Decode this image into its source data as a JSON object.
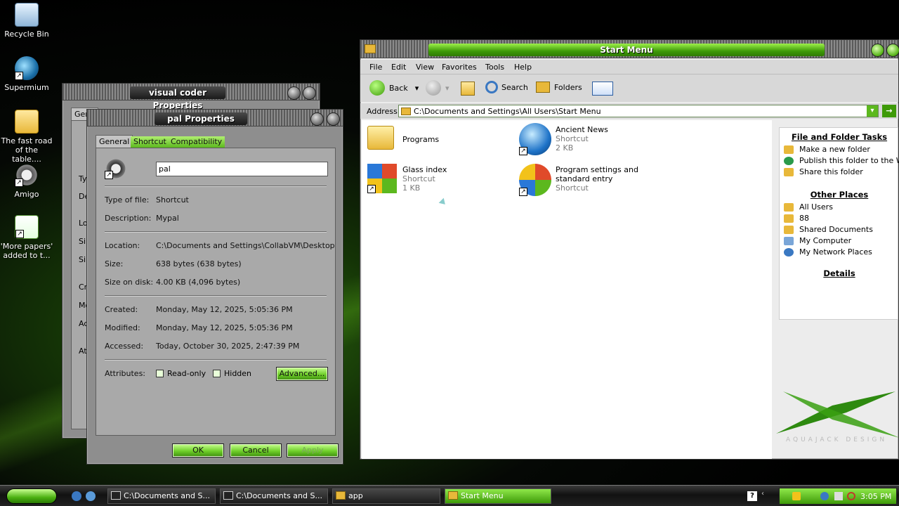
{
  "desktop": {
    "icons": [
      {
        "label": "Recycle Bin",
        "icon": "recycle-bin-icon"
      },
      {
        "label": "Supermium",
        "icon": "browser-icon"
      },
      {
        "label": "The fast road of the table....",
        "icon": "folder-icon"
      },
      {
        "label": "Amigo",
        "icon": "raccoon-icon"
      },
      {
        "label": "'More papers' added to t...",
        "icon": "notepad-icon"
      }
    ]
  },
  "bg_window": {
    "title": "visual coder Properties",
    "tab": "Gene",
    "labels": [
      "Ty",
      "De",
      "Lo",
      "Si",
      "Si",
      "Cr",
      "Mo",
      "Ac",
      "At"
    ]
  },
  "props": {
    "title": "pal Properties",
    "tabs": [
      "General",
      "Shortcut",
      "Compatibility"
    ],
    "name_value": "pal",
    "rows": [
      {
        "k": "Type of file:",
        "v": "Shortcut"
      },
      {
        "k": "Description:",
        "v": "Mypal"
      },
      {
        "k": "Location:",
        "v": "C:\\Documents and Settings\\CollabVM\\Desktop"
      },
      {
        "k": "Size:",
        "v": "638 bytes (638 bytes)"
      },
      {
        "k": "Size on disk:",
        "v": "4.00 KB (4,096 bytes)"
      },
      {
        "k": "Created:",
        "v": "Monday, May 12, 2025, 5:05:36 PM"
      },
      {
        "k": "Modified:",
        "v": "Monday, May 12, 2025, 5:05:36 PM"
      },
      {
        "k": "Accessed:",
        "v": "Today, October 30, 2025, 2:47:39 PM"
      }
    ],
    "attributes_label": "Attributes:",
    "readonly_label": "Read-only",
    "hidden_label": "Hidden",
    "advanced_label": "Advanced...",
    "ok_label": "OK",
    "cancel_label": "Cancel",
    "apply_label": "Apply"
  },
  "explorer": {
    "title": "Start Menu",
    "menu": [
      "File",
      "Edit",
      "View",
      "Favorites",
      "Tools",
      "Help"
    ],
    "back_label": "Back",
    "search_label": "Search",
    "folders_label": "Folders",
    "address_label": "Address",
    "address_value": "C:\\Documents and Settings\\All Users\\Start Menu",
    "items": [
      {
        "name": "Programs",
        "type": "",
        "size": ""
      },
      {
        "name": "Ancient News",
        "type": "Shortcut",
        "size": "2 KB"
      },
      {
        "name": "Glass index",
        "type": "Shortcut",
        "size": "1 KB"
      },
      {
        "name": "Program settings and standard entry",
        "type": "Shortcut",
        "size": ""
      }
    ],
    "tasks_header": "File and Folder Tasks",
    "tasks": [
      "Make a new folder",
      "Publish this folder to the Web",
      "Share this folder"
    ],
    "places_header": "Other Places",
    "places": [
      "All Users",
      "88",
      "Shared Documents",
      "My Computer",
      "My Network Places"
    ],
    "details_header": "Details",
    "watermark": "AQUAJACK DESIGN"
  },
  "taskbar": {
    "items": [
      "C:\\Documents and S...",
      "C:\\Documents and S...",
      "app",
      "Start Menu"
    ],
    "clock": "3:05 PM"
  },
  "colors": {
    "accent": "#5cb81e",
    "window": "#8e8e8e"
  }
}
